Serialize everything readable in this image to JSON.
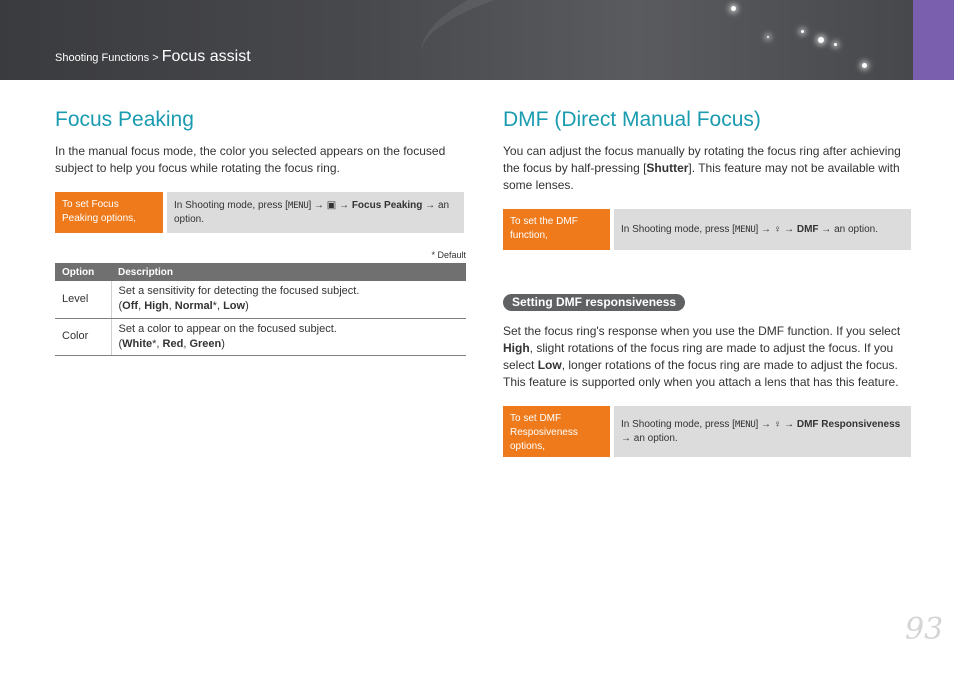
{
  "header": {
    "breadcrumb_parent": "Shooting Functions >",
    "breadcrumb_current": "Focus assist"
  },
  "focus_peaking": {
    "title": "Focus Peaking",
    "intro": "In the manual focus mode, the color you selected appears on the focused subject to help you focus while rotating the focus ring.",
    "howto_label": "To set Focus Peaking options,",
    "howto_steps": {
      "prefix": "In Shooting mode, press [",
      "menu": "MENU",
      "after_menu": "] → ",
      "camera_icon": "▣",
      "arrow": " → ",
      "bold": "Focus Peaking",
      "suffix": " → an option."
    },
    "default_note": "* Default",
    "table": {
      "headers": [
        "Option",
        "Description"
      ],
      "rows": [
        {
          "option": "Level",
          "desc_line1": "Set a sensitivity for detecting the focused subject.",
          "values": [
            "Off",
            "High",
            "Normal",
            "Low"
          ]
        },
        {
          "option": "Color",
          "desc_line1": "Set a color to appear on the focused subject.",
          "values": [
            "White",
            "Red",
            "Green"
          ]
        }
      ]
    }
  },
  "dmf": {
    "title": "DMF (Direct Manual Focus)",
    "intro_1": "You can adjust the focus manually by rotating the focus ring after achieving the focus by half-pressing [",
    "intro_bold": "Shutter",
    "intro_2": "]. This feature may not be available with some lenses.",
    "howto_label": "To set the DMF function,",
    "howto_steps": {
      "prefix": "In Shooting mode, press [",
      "menu": "MENU",
      "after_menu": "] → ",
      "af_icon": "♀",
      "arrow": " → ",
      "bold": "DMF",
      "suffix": " → an option."
    },
    "sub": {
      "title": "Setting DMF responsiveness",
      "p1": "Set the focus ring's response when you use the DMF function. If you select ",
      "b1": "High",
      "p2": ", slight rotations of the focus ring are made to adjust the focus. If you select ",
      "b2": "Low",
      "p3": ", longer rotations of the focus ring are made to adjust the focus. This feature is supported only when you attach a lens that has this feature.",
      "howto_label": "To set DMF Resposiveness options,",
      "howto_steps": {
        "prefix": "In Shooting mode, press [",
        "menu": "MENU",
        "after_menu": "] → ",
        "af_icon": "♀",
        "arrow": " → ",
        "bold": "DMF Responsiveness",
        "suffix": " → an option."
      }
    }
  },
  "page_number": "93",
  "colors": {
    "accent_teal": "#1a9bb0",
    "label_orange": "#ee7a1b",
    "tab_purple": "#7a5fae",
    "table_header": "#707070"
  }
}
